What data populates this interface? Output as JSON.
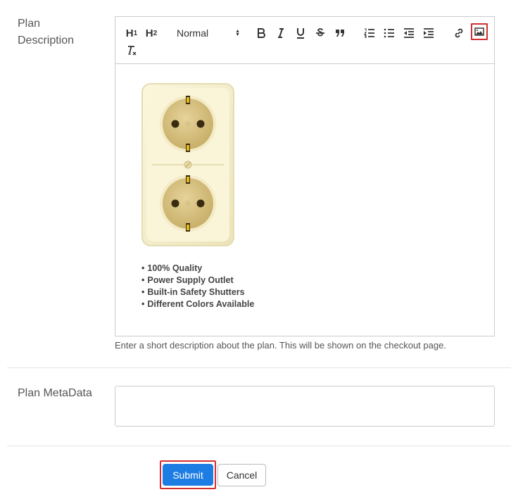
{
  "form": {
    "description_label": "Plan Description",
    "description_help": "Enter a short description about the plan. This will be shown on the checkout page.",
    "metadata_label": "Plan MetaData",
    "metadata_value": ""
  },
  "toolbar": {
    "h1": "H",
    "h1_sub": "1",
    "h2": "H",
    "h2_sub": "2",
    "font_size": "Normal",
    "highlight_color": "#d32f2f"
  },
  "editor_content": {
    "image_icon": "power-outlet-image",
    "bullets": [
      "100% Quality",
      "Power Supply Outlet",
      "Built-in Safety Shutters",
      "Different Colors Available"
    ]
  },
  "buttons": {
    "submit": "Submit",
    "cancel": "Cancel",
    "submit_color": "#1e7de3"
  }
}
